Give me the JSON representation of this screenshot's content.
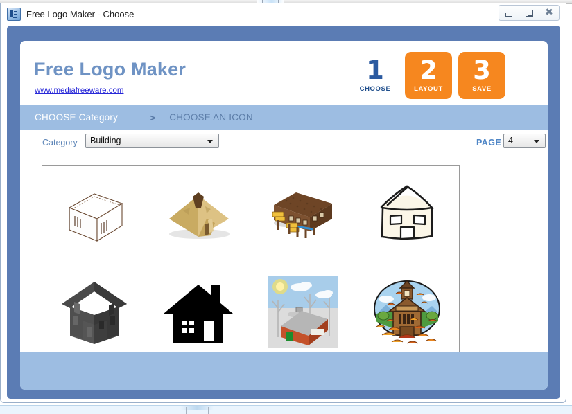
{
  "window": {
    "title": "Free Logo Maker - Choose",
    "app_icon": "app-icon",
    "controls": {
      "minimize_label": "Minimize",
      "maximize_label": "Maximize",
      "close_label": "Close",
      "close_glyph": "✖"
    }
  },
  "brand": {
    "title": "Free Logo Maker",
    "link": "www.mediafreeware.com"
  },
  "steps": [
    {
      "number": "1",
      "label": "CHOOSE",
      "state": "active"
    },
    {
      "number": "2",
      "label": "LAYOUT",
      "state": "inactive"
    },
    {
      "number": "3",
      "label": "SAVE",
      "state": "inactive"
    }
  ],
  "breadcrumb": {
    "active": "CHOOSE Category",
    "separator": ">",
    "next": "CHOOSE AN ICON"
  },
  "controls": {
    "category_label": "Category",
    "category_value": "Building",
    "page_label": "PAGE",
    "page_value": "4"
  },
  "icons": [
    {
      "name": "isometric-outline-house-icon",
      "alt": "Isometric line-drawn house"
    },
    {
      "name": "pyramid-icon",
      "alt": "Golden pyramid"
    },
    {
      "name": "brown-stilt-longhouse-icon",
      "alt": "Brown wooden longhouse on stilts"
    },
    {
      "name": "sketch-house-icon",
      "alt": "Hand-drawn cream house outline"
    },
    {
      "name": "grey-3d-house-icon",
      "alt": "Dark grey three-dimensional house"
    },
    {
      "name": "black-house-silhouette-icon",
      "alt": "Black house silhouette with chimney"
    },
    {
      "name": "winter-cottage-scene-icon",
      "alt": "Winter scene with sun, clouds and red cottage"
    },
    {
      "name": "autumn-schoolhouse-icon",
      "alt": "Oval schoolhouse with autumn leaves"
    }
  ],
  "colors": {
    "frame_blue": "#5b7cb4",
    "bar_blue": "#9dbde2",
    "brand_blue": "#6f93c4",
    "accent_orange": "#f6871f",
    "link_blue": "#2727d8"
  }
}
